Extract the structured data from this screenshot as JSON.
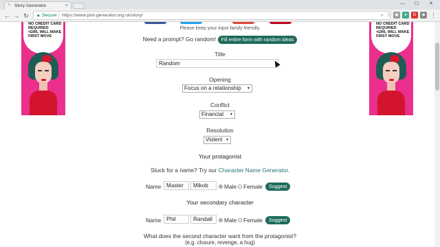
{
  "browser": {
    "tab_title": "Story Generator",
    "secure_label": "Secure",
    "url": "https://www.plot-generator.org.uk/story/"
  },
  "ads": {
    "lines": [
      "NO CREDIT CARD",
      "REQUIRED",
      "•GIRL WILL MAKE",
      "FIRST MOVE"
    ],
    "colors": {
      "background": "#ea2f8c",
      "dress": "#d3142e",
      "hair": "#1d5d55"
    }
  },
  "form": {
    "notice": "Please keep your input family friendly.",
    "prompt_text": "Need a prompt? Go random!",
    "random_button": "Fill entire form with random ideas",
    "title_label": "Title",
    "title_value": "Random",
    "opening_label": "Opening",
    "opening_value": "Focus on a relationship",
    "conflict_label": "Conflict",
    "conflict_value": "Financial",
    "resolution_label": "Resolution",
    "resolution_value": "Violent",
    "protagonist_heading": "Your protagonist",
    "stuck_text": "Stuck for a name? Try our",
    "name_generator_link": "Character Name Generator",
    "stuck_period": ".",
    "protagonist": {
      "name_label": "Name",
      "first": "Master",
      "last": "Mikob",
      "male": "Male",
      "female": "Female",
      "selected": "Male",
      "suggest": "Suggest"
    },
    "secondary_heading": "Your secondary character",
    "secondary": {
      "name_label": "Name",
      "first": "Phil",
      "last": "Randall",
      "male": "Male",
      "female": "Female",
      "selected": "Male",
      "suggest": "Suggest"
    },
    "want_question": "What does the second character want from the protagonist?",
    "want_hint": "(e.g. closure, revenge, a hug)"
  },
  "colors": {
    "accent": "#1e6b5c",
    "link": "#2a6e77",
    "secure": "#0b8043"
  }
}
